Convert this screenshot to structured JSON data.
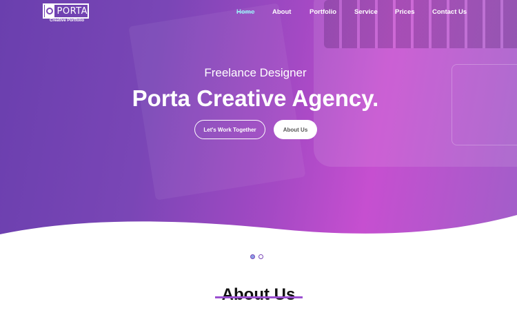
{
  "brand": {
    "logo_text": "PORTA",
    "tagline": "Creative Portfolio"
  },
  "nav": {
    "items": [
      {
        "label": "Home",
        "active": true
      },
      {
        "label": "About",
        "active": false
      },
      {
        "label": "Portfolio",
        "active": false
      },
      {
        "label": "Service",
        "active": false
      },
      {
        "label": "Prices",
        "active": false
      },
      {
        "label": "Contact Us",
        "active": false
      }
    ]
  },
  "hero": {
    "subtitle": "Freelance Designer",
    "title": "Porta Creative Agency.",
    "primary_button": "Let's Work Together",
    "secondary_button": "About Us",
    "gradient_start": "#6a3fae",
    "gradient_end": "#c64fd0"
  },
  "slider": {
    "dots": 2,
    "active_index": 0
  },
  "about": {
    "heading": "About Us"
  },
  "colors": {
    "accent": "#9b4fd0",
    "nav_active": "#9ce4f4"
  }
}
